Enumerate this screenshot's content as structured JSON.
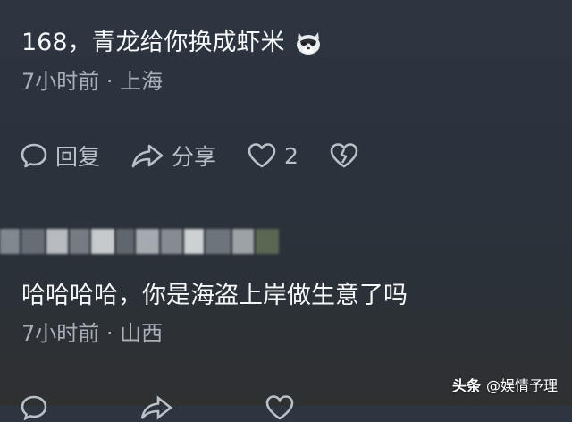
{
  "comments": [
    {
      "text": "168，青龙给你换成虾米",
      "emoji": "cool-wolf-emoji",
      "meta": "7小时前 · 上海"
    },
    {
      "text": "哈哈哈哈，你是海盗上岸做生意了吗",
      "meta": "7小时前 · 山西"
    }
  ],
  "actions": {
    "reply_label": "回复",
    "share_label": "分享",
    "like_count": "2"
  },
  "watermark": {
    "brand": "头条",
    "handle": "@娱情予理"
  },
  "colors": {
    "background": "#2b323b",
    "text": "#f5f7f9",
    "meta": "#a9b0b8",
    "action": "#b9c0c7"
  }
}
